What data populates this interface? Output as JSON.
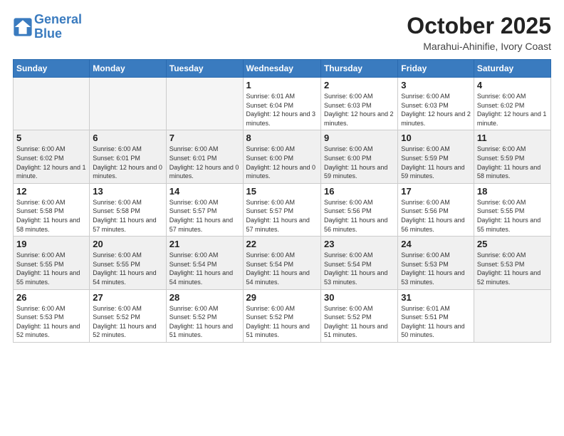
{
  "logo": {
    "line1": "General",
    "line2": "Blue"
  },
  "title": "October 2025",
  "location": "Marahui-Ahinifie, Ivory Coast",
  "weekdays": [
    "Sunday",
    "Monday",
    "Tuesday",
    "Wednesday",
    "Thursday",
    "Friday",
    "Saturday"
  ],
  "weeks": [
    [
      {
        "day": "",
        "info": ""
      },
      {
        "day": "",
        "info": ""
      },
      {
        "day": "",
        "info": ""
      },
      {
        "day": "1",
        "info": "Sunrise: 6:01 AM\nSunset: 6:04 PM\nDaylight: 12 hours and 3 minutes."
      },
      {
        "day": "2",
        "info": "Sunrise: 6:00 AM\nSunset: 6:03 PM\nDaylight: 12 hours and 2 minutes."
      },
      {
        "day": "3",
        "info": "Sunrise: 6:00 AM\nSunset: 6:03 PM\nDaylight: 12 hours and 2 minutes."
      },
      {
        "day": "4",
        "info": "Sunrise: 6:00 AM\nSunset: 6:02 PM\nDaylight: 12 hours and 1 minute."
      }
    ],
    [
      {
        "day": "5",
        "info": "Sunrise: 6:00 AM\nSunset: 6:02 PM\nDaylight: 12 hours and 1 minute."
      },
      {
        "day": "6",
        "info": "Sunrise: 6:00 AM\nSunset: 6:01 PM\nDaylight: 12 hours and 0 minutes."
      },
      {
        "day": "7",
        "info": "Sunrise: 6:00 AM\nSunset: 6:01 PM\nDaylight: 12 hours and 0 minutes."
      },
      {
        "day": "8",
        "info": "Sunrise: 6:00 AM\nSunset: 6:00 PM\nDaylight: 12 hours and 0 minutes."
      },
      {
        "day": "9",
        "info": "Sunrise: 6:00 AM\nSunset: 6:00 PM\nDaylight: 11 hours and 59 minutes."
      },
      {
        "day": "10",
        "info": "Sunrise: 6:00 AM\nSunset: 5:59 PM\nDaylight: 11 hours and 59 minutes."
      },
      {
        "day": "11",
        "info": "Sunrise: 6:00 AM\nSunset: 5:59 PM\nDaylight: 11 hours and 58 minutes."
      }
    ],
    [
      {
        "day": "12",
        "info": "Sunrise: 6:00 AM\nSunset: 5:58 PM\nDaylight: 11 hours and 58 minutes."
      },
      {
        "day": "13",
        "info": "Sunrise: 6:00 AM\nSunset: 5:58 PM\nDaylight: 11 hours and 57 minutes."
      },
      {
        "day": "14",
        "info": "Sunrise: 6:00 AM\nSunset: 5:57 PM\nDaylight: 11 hours and 57 minutes."
      },
      {
        "day": "15",
        "info": "Sunrise: 6:00 AM\nSunset: 5:57 PM\nDaylight: 11 hours and 57 minutes."
      },
      {
        "day": "16",
        "info": "Sunrise: 6:00 AM\nSunset: 5:56 PM\nDaylight: 11 hours and 56 minutes."
      },
      {
        "day": "17",
        "info": "Sunrise: 6:00 AM\nSunset: 5:56 PM\nDaylight: 11 hours and 56 minutes."
      },
      {
        "day": "18",
        "info": "Sunrise: 6:00 AM\nSunset: 5:55 PM\nDaylight: 11 hours and 55 minutes."
      }
    ],
    [
      {
        "day": "19",
        "info": "Sunrise: 6:00 AM\nSunset: 5:55 PM\nDaylight: 11 hours and 55 minutes."
      },
      {
        "day": "20",
        "info": "Sunrise: 6:00 AM\nSunset: 5:55 PM\nDaylight: 11 hours and 54 minutes."
      },
      {
        "day": "21",
        "info": "Sunrise: 6:00 AM\nSunset: 5:54 PM\nDaylight: 11 hours and 54 minutes."
      },
      {
        "day": "22",
        "info": "Sunrise: 6:00 AM\nSunset: 5:54 PM\nDaylight: 11 hours and 54 minutes."
      },
      {
        "day": "23",
        "info": "Sunrise: 6:00 AM\nSunset: 5:54 PM\nDaylight: 11 hours and 53 minutes."
      },
      {
        "day": "24",
        "info": "Sunrise: 6:00 AM\nSunset: 5:53 PM\nDaylight: 11 hours and 53 minutes."
      },
      {
        "day": "25",
        "info": "Sunrise: 6:00 AM\nSunset: 5:53 PM\nDaylight: 11 hours and 52 minutes."
      }
    ],
    [
      {
        "day": "26",
        "info": "Sunrise: 6:00 AM\nSunset: 5:53 PM\nDaylight: 11 hours and 52 minutes."
      },
      {
        "day": "27",
        "info": "Sunrise: 6:00 AM\nSunset: 5:52 PM\nDaylight: 11 hours and 52 minutes."
      },
      {
        "day": "28",
        "info": "Sunrise: 6:00 AM\nSunset: 5:52 PM\nDaylight: 11 hours and 51 minutes."
      },
      {
        "day": "29",
        "info": "Sunrise: 6:00 AM\nSunset: 5:52 PM\nDaylight: 11 hours and 51 minutes."
      },
      {
        "day": "30",
        "info": "Sunrise: 6:00 AM\nSunset: 5:52 PM\nDaylight: 11 hours and 51 minutes."
      },
      {
        "day": "31",
        "info": "Sunrise: 6:01 AM\nSunset: 5:51 PM\nDaylight: 11 hours and 50 minutes."
      },
      {
        "day": "",
        "info": ""
      }
    ]
  ]
}
